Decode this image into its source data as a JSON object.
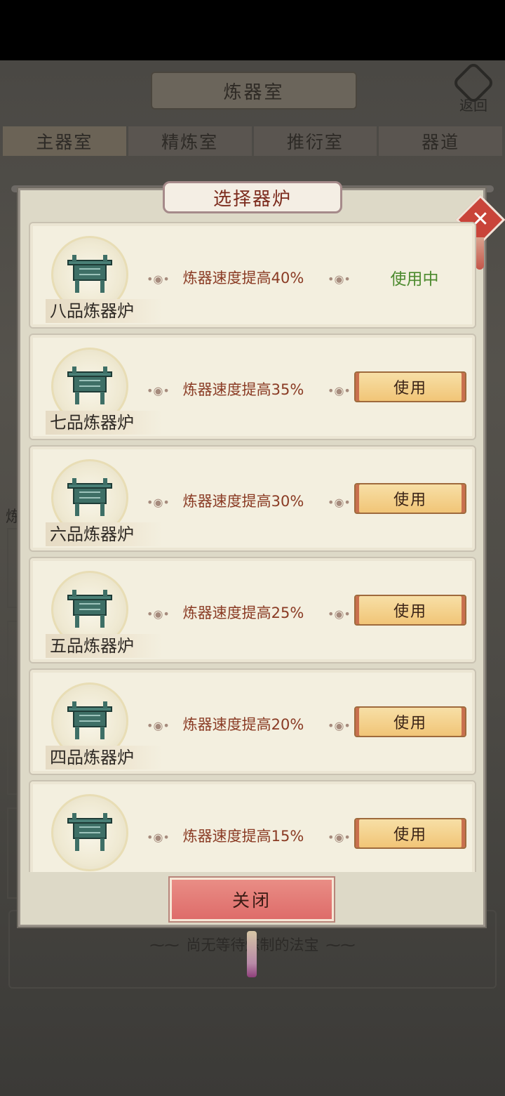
{
  "header": {
    "title": "炼器室",
    "back_label": "返回"
  },
  "tabs": [
    "主器室",
    "精炼室",
    "推衍室",
    "器道"
  ],
  "background": {
    "side_label": "炼",
    "empty_text": "尚无等待炼制的法宝"
  },
  "dialog": {
    "title": "选择器炉",
    "close_button_label": "关闭",
    "close_icon_glyph": "✕",
    "items": [
      {
        "name": "八品炼器炉",
        "effect": "炼器速度提高40%",
        "status": "使用中"
      },
      {
        "name": "七品炼器炉",
        "effect": "炼器速度提高35%",
        "button": "使用"
      },
      {
        "name": "六品炼器炉",
        "effect": "炼器速度提高30%",
        "button": "使用"
      },
      {
        "name": "五品炼器炉",
        "effect": "炼器速度提高25%",
        "button": "使用"
      },
      {
        "name": "四品炼器炉",
        "effect": "炼器速度提高20%",
        "button": "使用"
      },
      {
        "effect": "炼器速度提高15%",
        "button": "使用"
      }
    ]
  },
  "colors": {
    "accent_red": "#8a3b24",
    "in_use_green": "#4c8a2e",
    "button_gold": "#f1c577"
  }
}
